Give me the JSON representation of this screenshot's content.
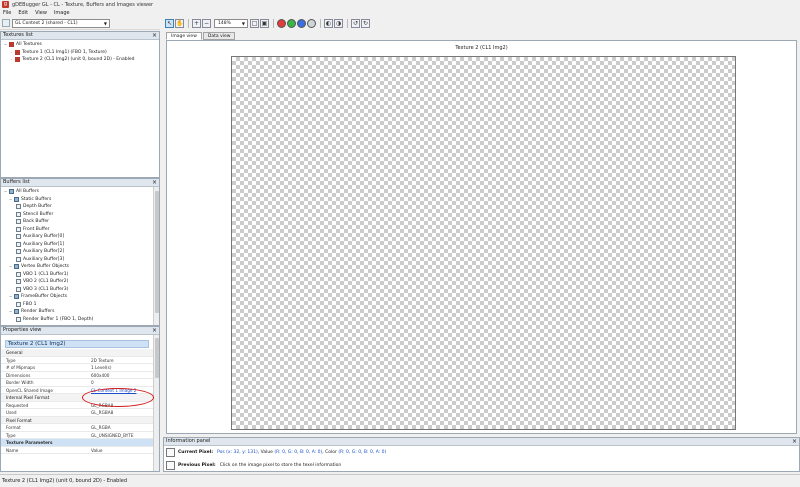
{
  "window": {
    "title": "gDEBugger GL - CL - Texture, Buffers and Images viewer",
    "app_icon_glyph": "g"
  },
  "menu": [
    "File",
    "Edit",
    "View",
    "Image"
  ],
  "left_toolbar": {
    "context": "GL Context 2 (shared - CL1)"
  },
  "right_toolbar": {
    "zoom": "148%"
  },
  "textures_panel": {
    "title": "Textures list",
    "items": [
      "All Textures",
      "Texture 1 (CL1 Img1) (FBO 1, Texture)",
      "Texture 2 (CL1 Img2) (unit 0, bound 2D) - Enabled"
    ]
  },
  "buffers_panel": {
    "title": "Buffers list",
    "items": [
      "All Buffers",
      "Static Buffers",
      "Depth Buffer",
      "Stencil Buffer",
      "Back Buffer",
      "Front Buffer",
      "Auxiliary Buffer[0]",
      "Auxiliary Buffer[1]",
      "Auxiliary Buffer[2]",
      "Auxiliary Buffer[3]",
      "Vertex Buffer Objects",
      "VBO 1 (CL1 Buffer1)",
      "VBO 2 (CL1 Buffer2)",
      "VBO 3 (CL1 Buffer3)",
      "FrameBuffer Objects",
      "FBO 1",
      "Render Buffers",
      "Render Buffer 1 (FBO 1, Depth)"
    ]
  },
  "props_panel": {
    "title": "Properties view",
    "heading": "Texture 2 (CL1 Img2)",
    "section_general": "General",
    "type_k": "Type",
    "type_v": "2D Texture",
    "mip_k": "# of Mipmaps",
    "mip_v": "1 Level(s)",
    "dim_k": "Dimensions",
    "dim_v": "600x400",
    "border_k": "Border Width",
    "border_v": "0",
    "shared_k": "OpenCL Shared Image",
    "shared_v": "CL Context 1 Image 2",
    "section_internal": "Internal Pixel Format",
    "req_k": "Requested",
    "req_v": "GL_RGBA8",
    "used_k": "Used",
    "used_v": "GL_RGBA8",
    "section_pixel": "Pixel Format",
    "fmt_k": "Format",
    "fmt_v": "GL_RGBA",
    "ptype_k": "Type",
    "ptype_v": "GL_UNSIGNED_BYTE",
    "section_tex_params": "Texture Parameters",
    "name_k": "Name",
    "name_v": "Value"
  },
  "viewer": {
    "tabs": [
      "Image view",
      "Data view"
    ],
    "caption": "Texture 2 (CL1 Img2)"
  },
  "info_panel": {
    "title": "Information panel",
    "current_label": "Current Pixel:",
    "current_pos": "Pos (x: 32, y: 131)",
    "current_value_k": ", Value",
    "current_value": "(R: 0, G: 0, B: 0, A: 0)",
    "current_color_k": ", Color",
    "current_color": "(R: 0, G: 0, B: 0, A: 0)",
    "previous_label": "Previous Pixel:",
    "previous_text": "Click on the image pixel to store the texel information"
  },
  "statusbar": {
    "text": "Texture 2 (CL1 Img2) (unit 0, bound 2D) - Enabled"
  },
  "colors": {
    "highlight": "#d21717",
    "link": "#1a4fc9",
    "header": "#dfe6ee"
  }
}
